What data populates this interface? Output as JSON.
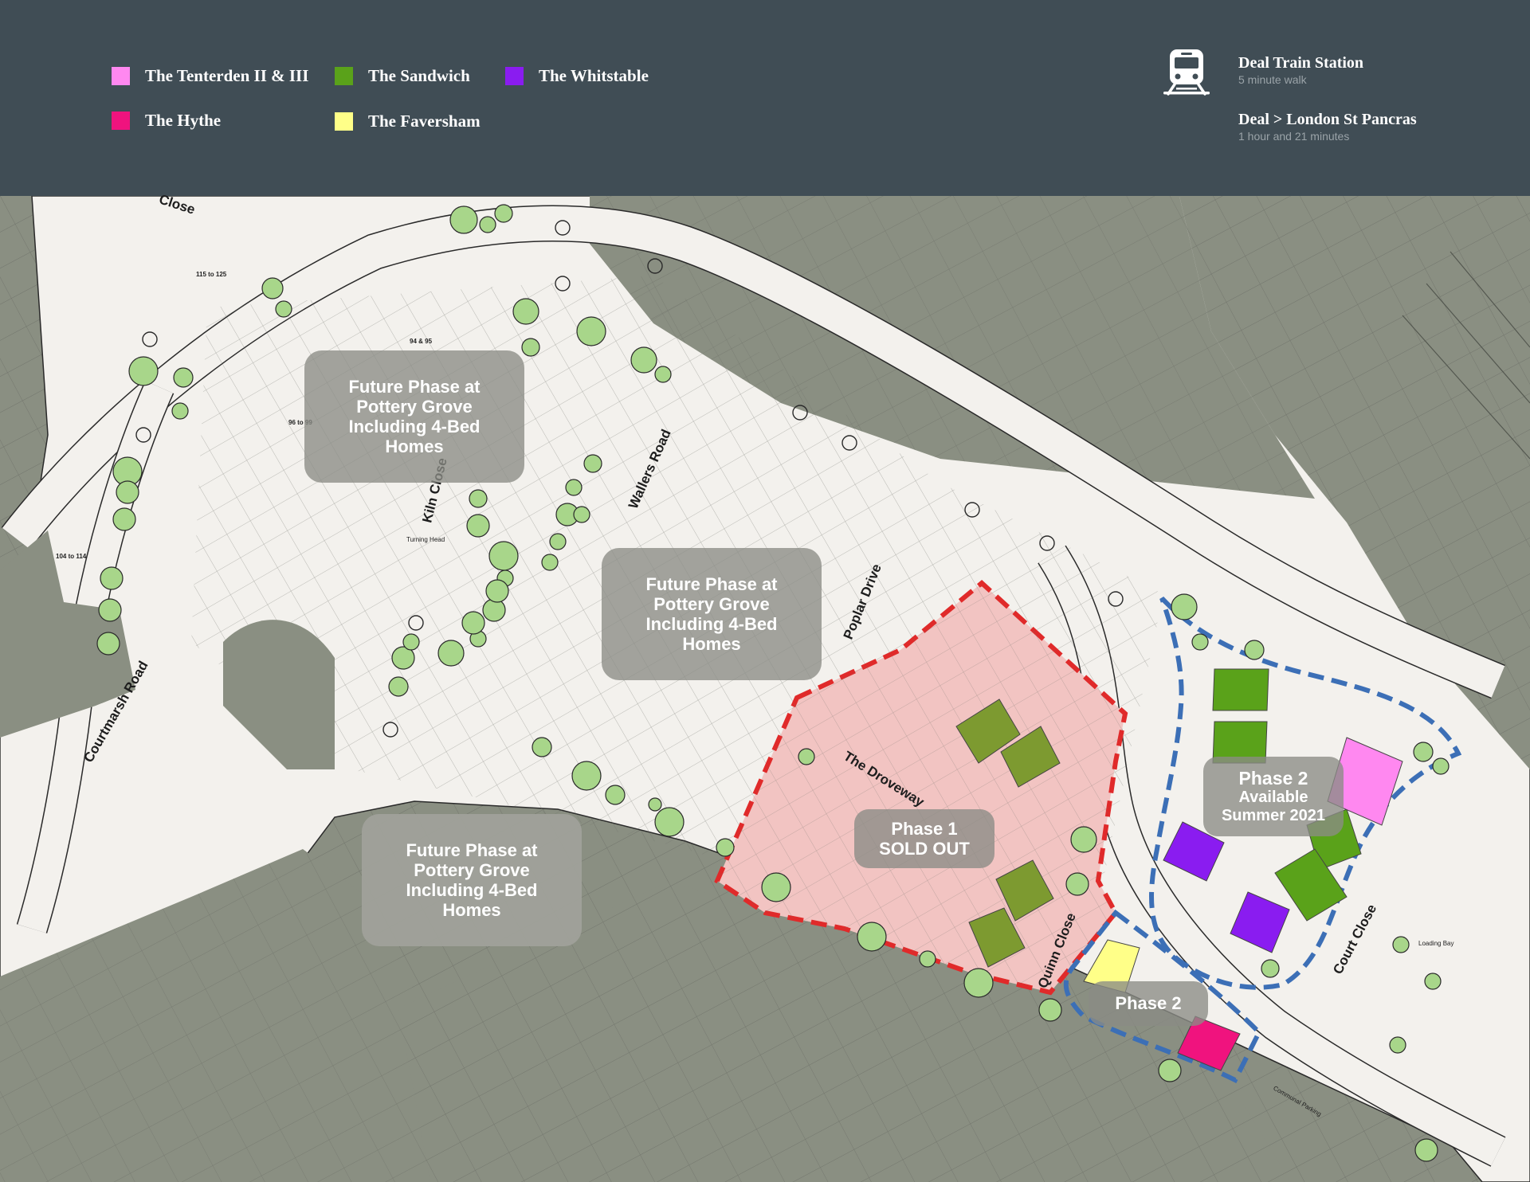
{
  "legend": {
    "items": [
      {
        "label": "The Tenterden II & III",
        "color": "#ff88f0"
      },
      {
        "label": "The Sandwich",
        "color": "#5aa21a"
      },
      {
        "label": "The Whitstable",
        "color": "#8a1cf0"
      },
      {
        "label": "The Hythe",
        "color": "#f0137e"
      },
      {
        "label": "The Faversham",
        "color": "#ffff88"
      }
    ]
  },
  "transport": {
    "icon": "train-icon",
    "station_title": "Deal Train Station",
    "station_sub": "5 minute walk",
    "route_title": "Deal > London St Pancras",
    "route_sub": "1 hour and 21 minutes"
  },
  "roads": {
    "courtmarsh": "Courtmarsh Road",
    "kiln": "Kiln Close",
    "wallers": "Wallers Road",
    "poplar": "Poplar Drive",
    "droveway": "The Droveway",
    "quinn": "Quinn Close",
    "court": "Court Close",
    "close_top": "Close"
  },
  "phases": {
    "future_1": [
      "Future Phase at",
      "Pottery Grove",
      "Including 4-Bed",
      "Homes"
    ],
    "future_2": [
      "Future Phase at",
      "Pottery Grove",
      "Including 4-Bed",
      "Homes"
    ],
    "future_3": [
      "Future Phase at",
      "Pottery Grove",
      "Including 4-Bed",
      "Homes"
    ],
    "phase1": [
      "Phase 1",
      "SOLD OUT"
    ],
    "phase2_available": [
      "Phase 2",
      "Available",
      "Summer 2021"
    ],
    "phase2": "Phase 2"
  },
  "map_labels": {
    "turning_head": "Turning Head",
    "communal_parking": "Communal Parking",
    "loading_bay": "Loading Bay",
    "plot_115_125": "115 to 125",
    "plot_104_114": "104 to 114",
    "plot_94_95": "94 & 95",
    "plot_96_99": "96 to 99"
  },
  "colors": {
    "header_bg": "#404d55",
    "map_bg": "#8a8f82",
    "site_bg": "#f3f1ed",
    "phase1_fill": "#f2c4c2",
    "phase1_border": "#e02a2a",
    "phase2_border": "#3c6fb6"
  }
}
